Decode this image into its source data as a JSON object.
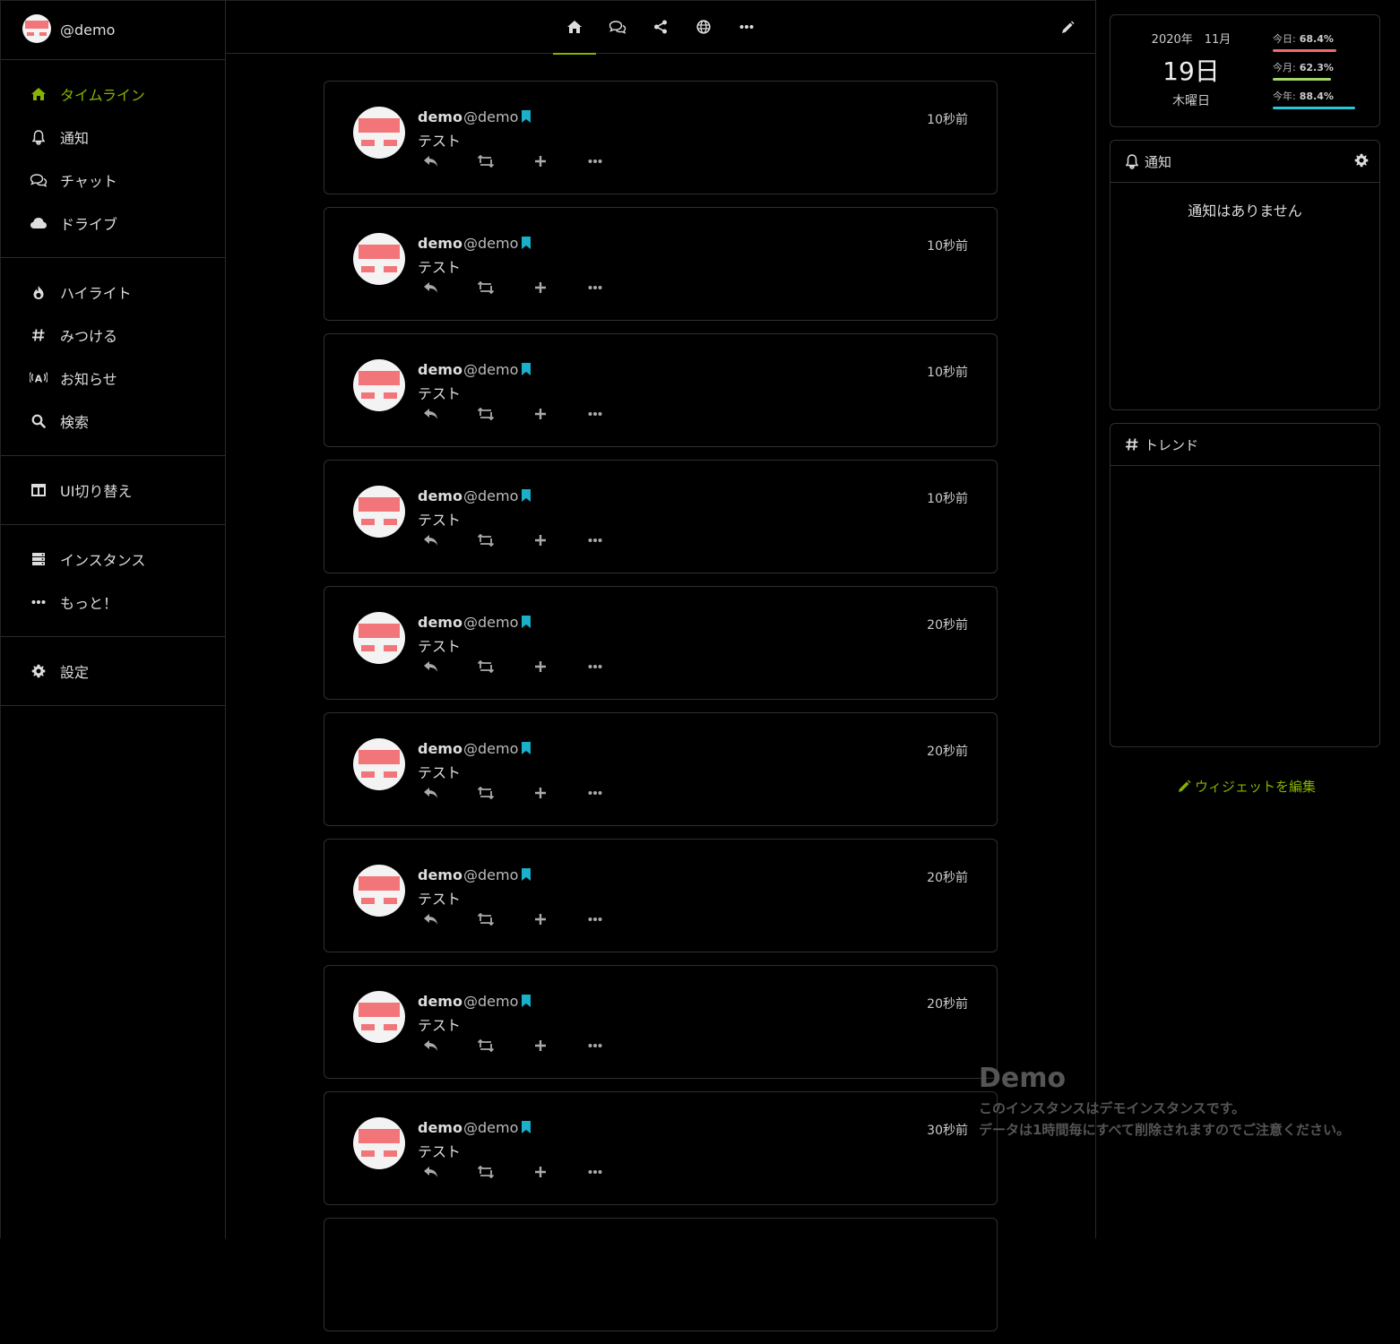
{
  "account": {
    "handle": "@demo"
  },
  "sidebar": {
    "groups": [
      [
        {
          "label": "タイムライン",
          "icon": "home-icon",
          "active": true
        },
        {
          "label": "通知",
          "icon": "bell-icon"
        },
        {
          "label": "チャット",
          "icon": "comments-icon"
        },
        {
          "label": "ドライブ",
          "icon": "cloud-icon"
        }
      ],
      [
        {
          "label": "ハイライト",
          "icon": "fire-icon"
        },
        {
          "label": "みつける",
          "icon": "hashtag-icon"
        },
        {
          "label": "お知らせ",
          "icon": "broadcast-icon"
        },
        {
          "label": "検索",
          "icon": "search-icon"
        }
      ],
      [
        {
          "label": "UI切り替え",
          "icon": "columns-icon"
        }
      ],
      [
        {
          "label": "インスタンス",
          "icon": "server-icon"
        },
        {
          "label": "もっと！",
          "icon": "ellipsis-icon"
        }
      ],
      [
        {
          "label": "設定",
          "icon": "gear-icon"
        }
      ]
    ]
  },
  "header": {
    "tabs": [
      "home-icon",
      "comments-icon",
      "share-icon",
      "globe-icon",
      "ellipsis-icon"
    ],
    "active_tab": 0
  },
  "timeline": {
    "notes": [
      {
        "name": "demo",
        "acct": "@demo",
        "text": "テスト",
        "time": "10秒前"
      },
      {
        "name": "demo",
        "acct": "@demo",
        "text": "テスト",
        "time": "10秒前"
      },
      {
        "name": "demo",
        "acct": "@demo",
        "text": "テスト",
        "time": "10秒前"
      },
      {
        "name": "demo",
        "acct": "@demo",
        "text": "テスト",
        "time": "10秒前"
      },
      {
        "name": "demo",
        "acct": "@demo",
        "text": "テスト",
        "time": "20秒前"
      },
      {
        "name": "demo",
        "acct": "@demo",
        "text": "テスト",
        "time": "20秒前"
      },
      {
        "name": "demo",
        "acct": "@demo",
        "text": "テスト",
        "time": "20秒前"
      },
      {
        "name": "demo",
        "acct": "@demo",
        "text": "テスト",
        "time": "20秒前"
      },
      {
        "name": "demo",
        "acct": "@demo",
        "text": "テスト",
        "time": "30秒前"
      },
      {
        "name": "",
        "acct": "",
        "text": "",
        "time": ""
      }
    ]
  },
  "calendar": {
    "year_month": "2020年　11月",
    "day": "19日",
    "weekday": "木曜日",
    "stats": [
      {
        "label": "今日:",
        "value": "68.4%",
        "fraction": 0.684,
        "color": "#f06b6b"
      },
      {
        "label": "今月:",
        "value": "62.3%",
        "fraction": 0.623,
        "color": "#a5d66a"
      },
      {
        "label": "今年:",
        "value": "88.4%",
        "fraction": 0.884,
        "color": "#25c8d8"
      }
    ]
  },
  "notifications_widget": {
    "title": "通知",
    "empty": "通知はありません"
  },
  "trends_widget": {
    "title": "トレンド"
  },
  "edit_widgets": "ウィジェットを編集",
  "demo_notice": {
    "title": "Demo",
    "line1": "このインスタンスはデモインスタンスです。",
    "line2": "データは1時間毎にすべて削除されますのでご注意ください。"
  },
  "colors": {
    "accent": "#86b300",
    "badge": "#1ab0c9",
    "avatar_red": "#f27579"
  }
}
